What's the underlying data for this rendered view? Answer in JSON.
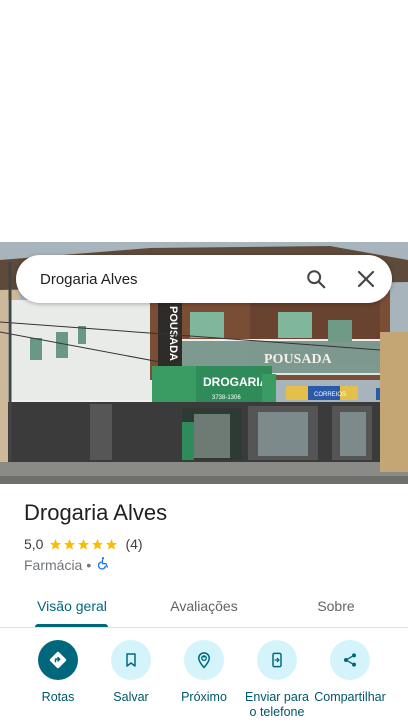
{
  "search": {
    "query": "Drogaria Alves"
  },
  "photo": {
    "signs": {
      "pousada_vertical": "POUSADA",
      "pousada_main": "POUSADA",
      "drogaria": "DROGARIA",
      "phone": "3738-1306",
      "correios": "CORREIOS"
    }
  },
  "place": {
    "name": "Drogaria Alves",
    "rating": "5,0",
    "stars": 5,
    "reviews": "(4)",
    "category": "Farmácia",
    "separator": "•"
  },
  "tabs": [
    {
      "label": "Visão geral",
      "active": true
    },
    {
      "label": "Avaliações",
      "active": false
    },
    {
      "label": "Sobre",
      "active": false
    }
  ],
  "actions": [
    {
      "label": "Rotas",
      "icon": "directions-icon"
    },
    {
      "label": "Salvar",
      "icon": "bookmark-icon"
    },
    {
      "label": "Próximo",
      "icon": "nearby-icon"
    },
    {
      "label": "Enviar para o telefone",
      "icon": "send-to-phone-icon"
    },
    {
      "label": "Compartilhar",
      "icon": "share-icon"
    }
  ],
  "colors": {
    "accent": "#00677d",
    "action_bg": "#d5f3fb",
    "star": "#fbbc04",
    "accessibility": "#1a73e8"
  }
}
